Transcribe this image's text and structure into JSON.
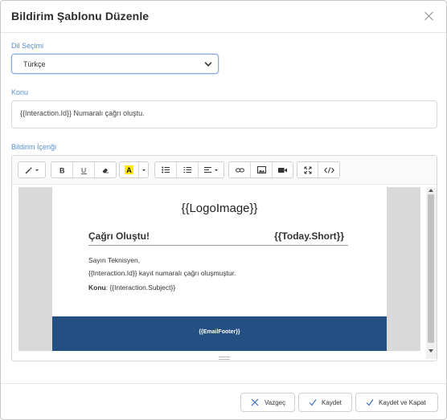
{
  "dialog": {
    "title": "Bildirim Şablonu Düzenle"
  },
  "language": {
    "label": "Dil Seçimi",
    "selected": "Türkçe"
  },
  "subject": {
    "label": "Konu",
    "value": "{{Interaction.Id}} Numaralı çağrı oluştu."
  },
  "body": {
    "label": "Bildirim İçeriği",
    "toolbar": [
      [
        "magic-wand-icon",
        "caret-down-icon"
      ],
      [
        "bold-icon",
        "underline-icon",
        "eraser-icon"
      ],
      [
        "highlight-icon",
        "caret-down-icon"
      ],
      [
        "bullet-list-icon",
        "numbered-list-icon",
        "align-icon"
      ],
      [
        "link-icon",
        "image-icon",
        "video-icon"
      ],
      [
        "fullscreen-icon",
        "code-view-icon"
      ]
    ],
    "preview": {
      "logo": "{{LogoImage}}",
      "heading": "Çağrı Oluştu!",
      "date": "{{Today.Short}}",
      "greeting": "Sayın Teknisyen,",
      "line2": "{{Interaction.Id}} kayıt numaralı çağrı oluşmuştur.",
      "subject_label": "Konu",
      "subject_value": ": {{Interaction.Subject}}",
      "footer": "{{EmailFooter}}",
      "footer_color": "#234f82"
    }
  },
  "buttons": {
    "cancel": "Vazgeç",
    "save": "Kaydet",
    "save_close": "Kaydet ve Kapat"
  },
  "colors": {
    "label": "#5a8fd0",
    "select_border": "#86a9e0",
    "footer_bg": "#234f82"
  }
}
